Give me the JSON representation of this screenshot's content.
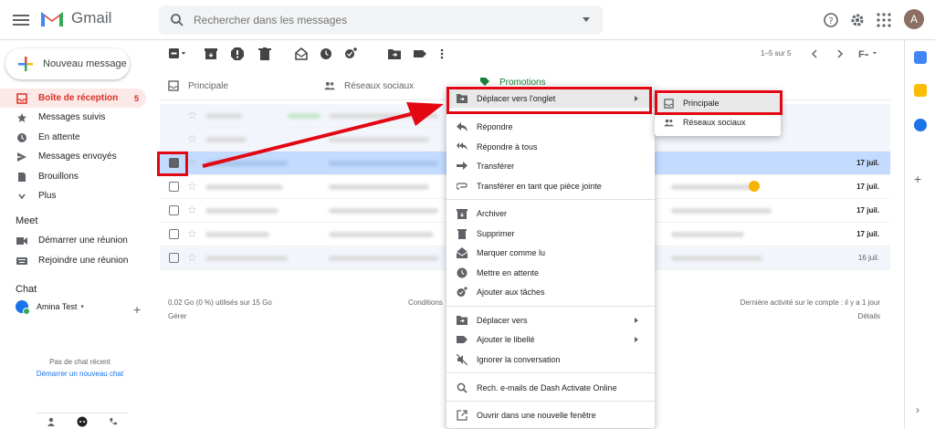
{
  "app": {
    "name": "Gmail"
  },
  "search": {
    "placeholder": "Rechercher dans les messages"
  },
  "account": {
    "initial": "A"
  },
  "sidebar": {
    "compose_label": "Nouveau message",
    "items": [
      {
        "label": "Boîte de réception",
        "count": "5"
      },
      {
        "label": "Messages suivis"
      },
      {
        "label": "En attente"
      },
      {
        "label": "Messages envoyés"
      },
      {
        "label": "Brouillons"
      },
      {
        "label": "Plus"
      }
    ],
    "meet_title": "Meet",
    "meet_items": [
      {
        "label": "Démarrer une réunion"
      },
      {
        "label": "Rejoindre une réunion"
      }
    ],
    "chat_title": "Chat",
    "chat_user": "Amina Test",
    "no_chat": "Pas de chat récent",
    "start_chat": "Démarrer un nouveau chat"
  },
  "toolbar": {
    "pager": "1–5 sur 5"
  },
  "tabs": [
    {
      "label": "Principale"
    },
    {
      "label": "Réseaux sociaux"
    },
    {
      "label": "Promotions"
    }
  ],
  "rows": [
    {
      "date": "17 juil."
    },
    {
      "date": "17 juil."
    },
    {
      "date": "17 juil."
    },
    {
      "date": "17 juil."
    },
    {
      "date": "16 juil."
    }
  ],
  "footer": {
    "storage": "0,02 Go (0 %) utilisés sur 15 Go",
    "manage": "Gérer",
    "conditions": "Conditions",
    "activity": "Dernière activité sur le compte : il y a 1 jour",
    "details": "Détails"
  },
  "context_menu": {
    "items": [
      {
        "label": "Déplacer vers l'onglet"
      },
      {
        "label": "Répondre"
      },
      {
        "label": "Répondre à tous"
      },
      {
        "label": "Transférer"
      },
      {
        "label": "Transférer en tant que pièce jointe"
      },
      {
        "label": "Archiver"
      },
      {
        "label": "Supprimer"
      },
      {
        "label": "Marquer comme lu"
      },
      {
        "label": "Mettre en attente"
      },
      {
        "label": "Ajouter aux tâches"
      },
      {
        "label": "Déplacer vers"
      },
      {
        "label": "Ajouter le libellé"
      },
      {
        "label": "Ignorer la conversation"
      },
      {
        "label": "Rech. e-mails de Dash Activate Online"
      },
      {
        "label": "Ouvrir dans une nouvelle fenêtre"
      }
    ]
  },
  "submenu": {
    "items": [
      {
        "label": "Principale"
      },
      {
        "label": "Réseaux sociaux"
      }
    ]
  },
  "colors": {
    "highlight": "#e30613",
    "accent_red": "#d93025",
    "blue": "#1a73e8"
  }
}
